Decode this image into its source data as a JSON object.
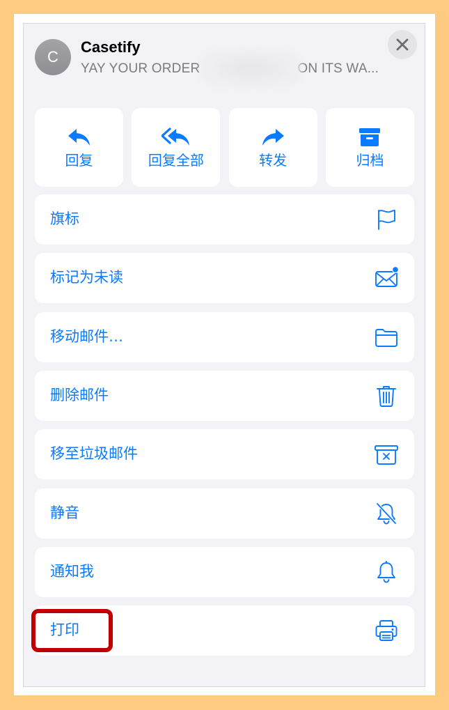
{
  "header": {
    "avatar_initial": "C",
    "sender": "Casetify",
    "subject_left": "YAY YOUR ORDER",
    "subject_right": "ON ITS WA..."
  },
  "quick_actions": [
    {
      "label": "回复",
      "icon": "reply-icon"
    },
    {
      "label": "回复全部",
      "icon": "reply-all-icon"
    },
    {
      "label": "转发",
      "icon": "forward-icon"
    },
    {
      "label": "归档",
      "icon": "archive-box-icon"
    }
  ],
  "menu_items": [
    {
      "label": "旗标",
      "icon": "flag-icon"
    },
    {
      "label": "标记为未读",
      "icon": "unread-envelope-icon"
    },
    {
      "label": "移动邮件…",
      "icon": "folder-icon"
    },
    {
      "label": "删除邮件",
      "icon": "trash-icon"
    },
    {
      "label": "移至垃圾邮件",
      "icon": "junk-bin-icon"
    },
    {
      "label": "静音",
      "icon": "bell-slash-icon"
    },
    {
      "label": "通知我",
      "icon": "bell-icon"
    },
    {
      "label": "打印",
      "icon": "printer-icon"
    }
  ],
  "colors": {
    "accent": "#0A7AFF",
    "sheet_background": "#F2F2F7",
    "outer_background": "#FFCB80",
    "highlight": "#C00000"
  }
}
